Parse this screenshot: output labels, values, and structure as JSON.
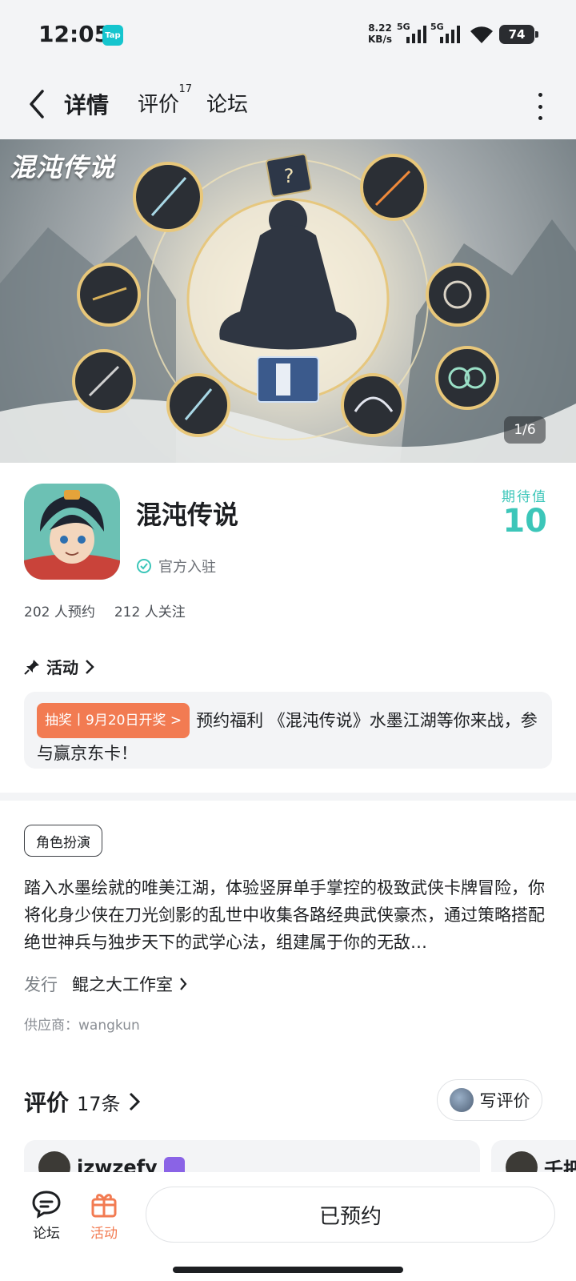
{
  "status_bar": {
    "time": "12:05",
    "app_badge": "Tap",
    "net_speed_value": "8.22",
    "net_speed_unit": "KB/s",
    "signal_tag_1": "5G",
    "signal_tag_2": "5G",
    "battery": "74"
  },
  "nav": {
    "tabs": [
      {
        "label": "详情"
      },
      {
        "label": "评价",
        "count": "17"
      },
      {
        "label": "论坛"
      }
    ]
  },
  "banner": {
    "title": "混沌传说",
    "page_indicator": "1/6"
  },
  "game": {
    "name": "混沌传说",
    "official_label": "官方入驻",
    "expect_label": "期待值",
    "expect_value": "10",
    "reservations": "202 人预约",
    "followers": "212 人关注"
  },
  "activity": {
    "header": "活动",
    "tag": "抽奖丨9月20日开奖 >",
    "text": "预约福利 《混沌传说》水墨江湖等你来战，参与赢京东卡！"
  },
  "details": {
    "genre_tag": "角色扮演",
    "description": "踏入水墨绘就的唯美江湖，体验竖屏单手掌控的极致武侠卡牌冒险，你将化身少侠在刀光剑影的乱世中收集各路经典武侠豪杰，通过策略搭配绝世神兵与独步天下的武学心法，组建属于你的无敌…",
    "publisher_label": "发行",
    "publisher_name": "鲲之大工作室",
    "supplier": "供应商：wangkun"
  },
  "reviews": {
    "title": "评价",
    "count": "17条",
    "write_label": "写评价",
    "first_user": "izwzefy",
    "second_user": "千把"
  },
  "bottom_bar": {
    "forum_label": "论坛",
    "activity_label": "活动",
    "reserved_label": "已预约"
  },
  "colors": {
    "accent_teal": "#3cc6b9",
    "accent_orange": "#f27b52",
    "surface_gray": "#f3f4f6"
  }
}
